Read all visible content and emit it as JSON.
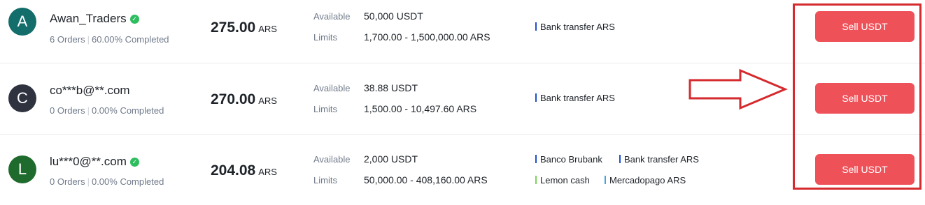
{
  "rows": [
    {
      "avatar": {
        "letter": "A",
        "color": "#126d6b"
      },
      "name": "Awan_Traders",
      "verified": true,
      "orders": "6 Orders",
      "completed": "60.00% Completed",
      "price": "275.00",
      "currency": "ARS",
      "available_label": "Available",
      "available": "50,000 USDT",
      "limits_label": "Limits",
      "limits": "1,700.00 - 1,500,000.00 ARS",
      "payments": [
        {
          "name": "Bank transfer ARS",
          "color": "#1f4fcc"
        }
      ],
      "action": "Sell USDT"
    },
    {
      "avatar": {
        "letter": "C",
        "color": "#2f3340"
      },
      "name": "co***b@**.com",
      "verified": false,
      "orders": "0 Orders",
      "completed": "0.00% Completed",
      "price": "270.00",
      "currency": "ARS",
      "available_label": "Available",
      "available": "38.88 USDT",
      "limits_label": "Limits",
      "limits": "1,500.00 - 10,497.60 ARS",
      "payments": [
        {
          "name": "Bank transfer ARS",
          "color": "#1f4fcc"
        }
      ],
      "action": "Sell USDT"
    },
    {
      "avatar": {
        "letter": "L",
        "color": "#1f6b2d"
      },
      "name": "lu***0@**.com",
      "verified": true,
      "orders": "0 Orders",
      "completed": "0.00% Completed",
      "price": "204.08",
      "currency": "ARS",
      "available_label": "Available",
      "available": "2,000 USDT",
      "limits_label": "Limits",
      "limits": "50,000.00 - 408,160.00 ARS",
      "payments": [
        {
          "name": "Banco Brubank",
          "color": "#1f4fcc"
        },
        {
          "name": "Bank transfer ARS",
          "color": "#1f4fcc"
        },
        {
          "name": "Lemon cash",
          "color": "#7fd35a"
        },
        {
          "name": "Mercadopago ARS",
          "color": "#3aa6e0"
        }
      ],
      "action": "Sell USDT"
    }
  ],
  "annotation": {
    "box_color": "#d52a2e",
    "arrow_color": "#d52a2e"
  }
}
